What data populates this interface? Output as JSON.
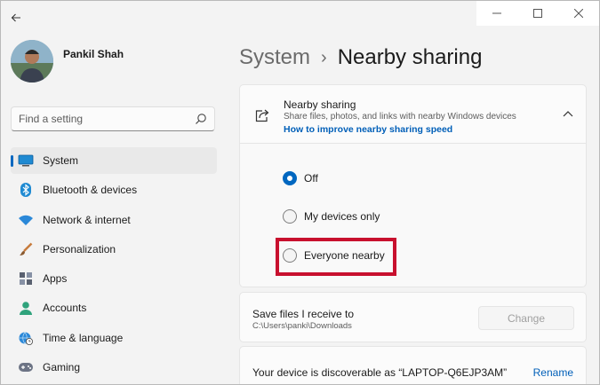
{
  "profile": {
    "name": "Pankil Shah"
  },
  "search": {
    "placeholder": "Find a setting"
  },
  "sidebar": {
    "items": [
      {
        "label": "System",
        "icon": "monitor-icon",
        "active": true
      },
      {
        "label": "Bluetooth & devices",
        "icon": "bluetooth-icon"
      },
      {
        "label": "Network & internet",
        "icon": "wifi-icon"
      },
      {
        "label": "Personalization",
        "icon": "brush-icon"
      },
      {
        "label": "Apps",
        "icon": "apps-icon"
      },
      {
        "label": "Accounts",
        "icon": "account-icon"
      },
      {
        "label": "Time & language",
        "icon": "globe-clock-icon"
      },
      {
        "label": "Gaming",
        "icon": "gamepad-icon"
      }
    ]
  },
  "breadcrumb": {
    "parent": "System",
    "separator": "›",
    "current": "Nearby sharing"
  },
  "nearby": {
    "title": "Nearby sharing",
    "description": "Share files, photos, and links with nearby Windows devices",
    "link": "How to improve nearby sharing speed",
    "options": [
      {
        "label": "Off",
        "checked": true
      },
      {
        "label": "My devices only",
        "checked": false
      },
      {
        "label": "Everyone nearby",
        "checked": false
      }
    ]
  },
  "save": {
    "title": "Save files I receive to",
    "path": "C:\\Users\\panki\\Downloads",
    "button": "Change"
  },
  "discover": {
    "text": "Your device is discoverable as “LAPTOP-Q6EJP3AM”",
    "action": "Rename"
  },
  "colors": {
    "accent": "#0067c0",
    "link": "#005fb8",
    "highlight": "#c8102e"
  }
}
